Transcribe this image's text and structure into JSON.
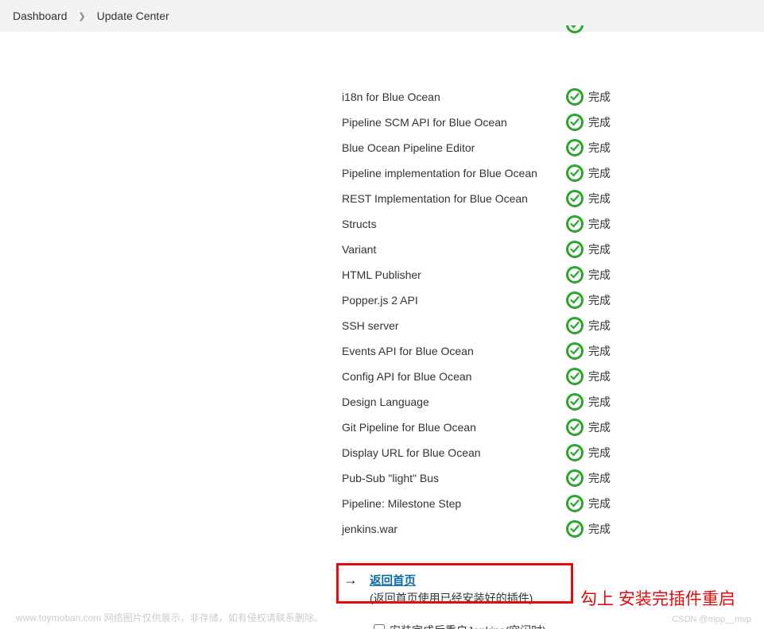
{
  "breadcrumb": {
    "dashboard": "Dashboard",
    "update_center": "Update Center"
  },
  "status_complete": "完成",
  "plugins": [
    {
      "name": "i18n for Blue Ocean",
      "status": "完成"
    },
    {
      "name": "Pipeline SCM API for Blue Ocean",
      "status": "完成"
    },
    {
      "name": "Blue Ocean Pipeline Editor",
      "status": "完成"
    },
    {
      "name": "Pipeline implementation for Blue Ocean",
      "status": "完成"
    },
    {
      "name": "REST Implementation for Blue Ocean",
      "status": "完成"
    },
    {
      "name": "Structs",
      "status": "完成"
    },
    {
      "name": "Variant",
      "status": "完成"
    },
    {
      "name": "HTML Publisher",
      "status": "完成"
    },
    {
      "name": "Popper.js 2 API",
      "status": "完成"
    },
    {
      "name": "SSH server",
      "status": "完成"
    },
    {
      "name": "Events API for Blue Ocean",
      "status": "完成"
    },
    {
      "name": "Config API for Blue Ocean",
      "status": "完成"
    },
    {
      "name": "Design Language",
      "status": "完成"
    },
    {
      "name": "Git Pipeline for Blue Ocean",
      "status": "完成"
    },
    {
      "name": "Display URL for Blue Ocean",
      "status": "完成"
    },
    {
      "name": "Pub-Sub \"light\" Bus",
      "status": "完成"
    },
    {
      "name": "Pipeline: Milestone Step",
      "status": "完成"
    },
    {
      "name": "jenkins.war",
      "status": "完成"
    }
  ],
  "footer": {
    "home_link": "返回首页",
    "home_desc": "(返回首页使用已经安装好的插件)",
    "restart_label": "安装完成后重启Jenkins(空闲时)"
  },
  "annotation": {
    "text": "勾上  安装完插件重启"
  },
  "watermark": {
    "left": "www.toymoban.com  网络图片仅供展示，非存储，如有侵权请联系删除。",
    "right": "CSDN @mpp__mvp"
  }
}
